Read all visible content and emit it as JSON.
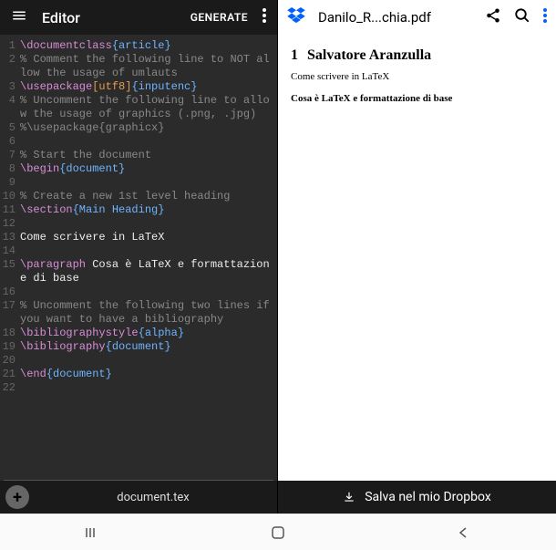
{
  "left": {
    "title": "Editor",
    "generate": "GENERATE",
    "filename": "document.tex",
    "lines": [
      {
        "n": 1,
        "t": "cmd",
        "cmd": "\\documentclass",
        "arg": "{article}"
      },
      {
        "n": 2,
        "t": "com",
        "text": "% Comment the following line to NOT allow the usage of umlauts"
      },
      {
        "n": 3,
        "t": "cmdopt",
        "cmd": "\\usepackage",
        "opt": "[utf8]",
        "arg": "{inputenc}"
      },
      {
        "n": 4,
        "t": "com",
        "text": "% Uncomment the following line to allow the usage of graphics (.png, .jpg)"
      },
      {
        "n": 5,
        "t": "com",
        "text": "%\\usepackage{graphicx}"
      },
      {
        "n": 6,
        "t": "blank"
      },
      {
        "n": 7,
        "t": "com",
        "text": "% Start the document"
      },
      {
        "n": 8,
        "t": "cmd",
        "cmd": "\\begin",
        "arg": "{document}"
      },
      {
        "n": 9,
        "t": "blank"
      },
      {
        "n": 10,
        "t": "com",
        "text": "% Create a new 1st level heading"
      },
      {
        "n": 11,
        "t": "cmd",
        "cmd": "\\section",
        "arg": "{Main Heading}"
      },
      {
        "n": 12,
        "t": "blank"
      },
      {
        "n": 13,
        "t": "txt",
        "text": "Come scrivere in LaTeX"
      },
      {
        "n": 14,
        "t": "blank"
      },
      {
        "n": 15,
        "t": "para",
        "cmd": "\\paragraph",
        "text": " Cosa è LaTeX e formattazione di base"
      },
      {
        "n": 16,
        "t": "blank"
      },
      {
        "n": 17,
        "t": "com",
        "text": "% Uncomment the following two lines if you want to have a bibliography"
      },
      {
        "n": 18,
        "t": "cmd",
        "cmd": "\\bibliographystyle",
        "arg": "{alpha}"
      },
      {
        "n": 19,
        "t": "cmd",
        "cmd": "\\bibliography",
        "arg": "{document}"
      },
      {
        "n": 20,
        "t": "blank"
      },
      {
        "n": 21,
        "t": "cmd",
        "cmd": "\\end",
        "arg": "{document}"
      },
      {
        "n": 22,
        "t": "blank"
      }
    ]
  },
  "right": {
    "filename": "Danilo_R...chia.pdf",
    "save": "Salva nel mio Dropbox",
    "preview": {
      "section_num": "1",
      "section_title": "Salvatore Aranzulla",
      "body": "Come scrivere in LaTeX",
      "para_bold": "Cosa è LaTeX e formattazione di base"
    }
  }
}
